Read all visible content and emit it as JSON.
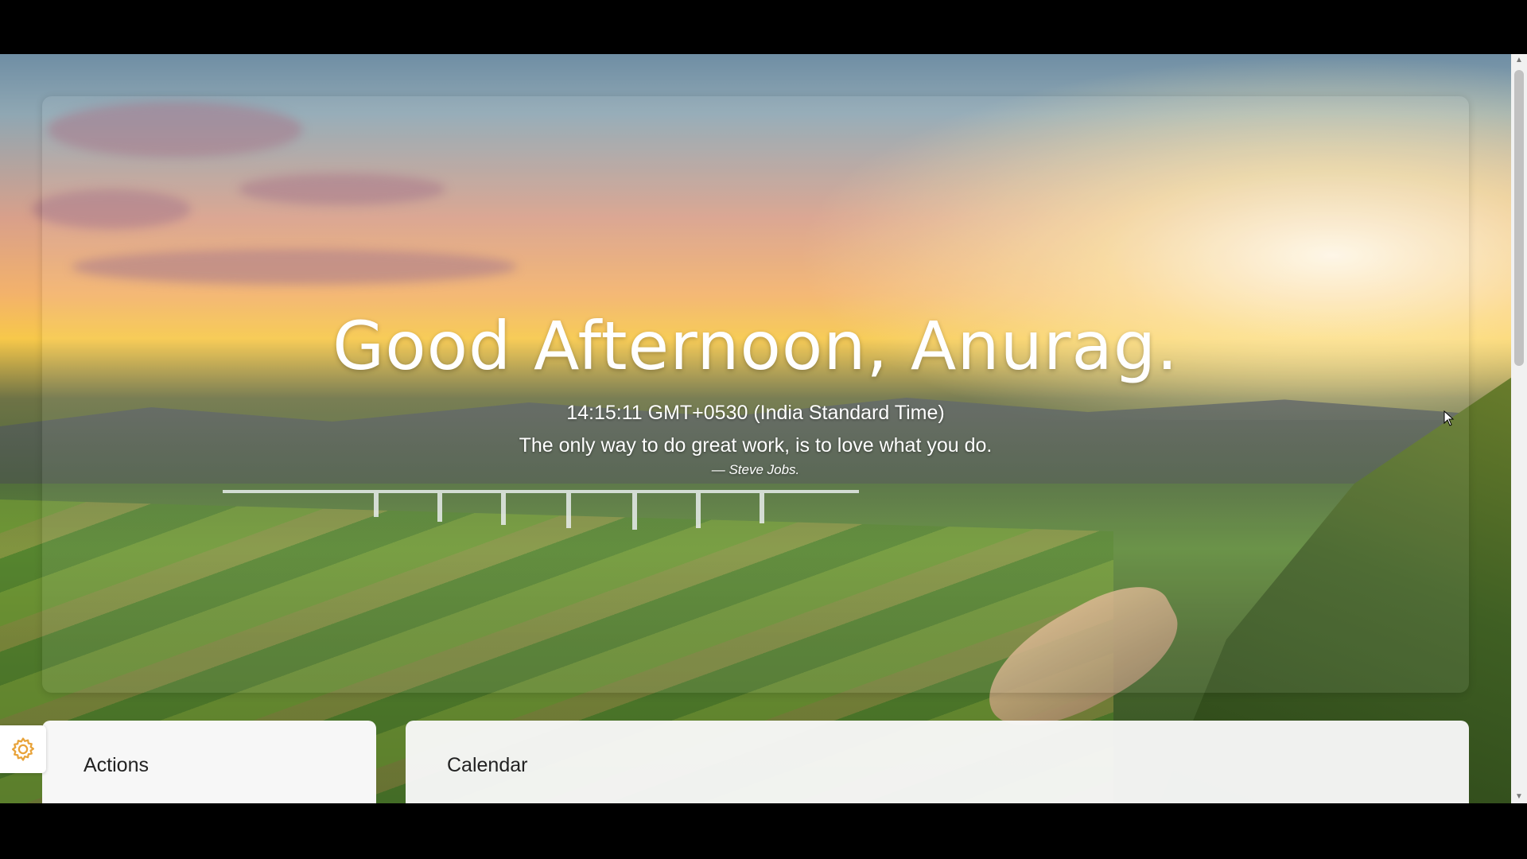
{
  "hero": {
    "greeting": "Good Afternoon, Anurag.",
    "clock": "14:15:11 GMT+0530 (India Standard Time)",
    "quote": "The only way to do great work, is to love what you do.",
    "author": "— Steve Jobs."
  },
  "cards": {
    "actions_title": "Actions",
    "calendar_title": "Calendar"
  },
  "icons": {
    "settings": "gear-icon",
    "scroll_up": "chevron-up-icon",
    "scroll_down": "chevron-down-icon",
    "cursor": "mouse-pointer-icon"
  },
  "colors": {
    "card_bg": "#f7f7f7",
    "text_light": "#ffffff",
    "text_dark": "#222222",
    "gear_accent": "#e8a33a"
  }
}
